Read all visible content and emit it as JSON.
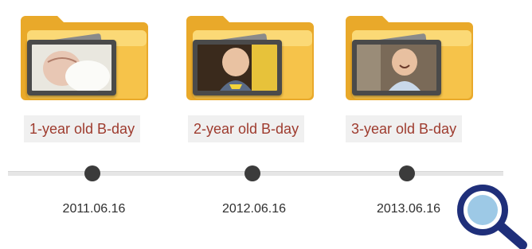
{
  "albums": [
    {
      "label": "1-year old B-day",
      "date": "2011.06.16"
    },
    {
      "label": "2-year old B-day",
      "date": "2012.06.16"
    },
    {
      "label": "3-year old B-day",
      "date": "2013.06.16"
    }
  ],
  "icons": {
    "album": "photo-folder-icon",
    "zoom": "magnifier-icon"
  },
  "colors": {
    "label_text": "#9e3b2e",
    "label_bg": "#f0f0f0",
    "folder": "#f6c34a",
    "timeline_dot": "#3b3b3b",
    "search_ring": "#1f2f7a",
    "search_lens": "#9dc9e6"
  }
}
